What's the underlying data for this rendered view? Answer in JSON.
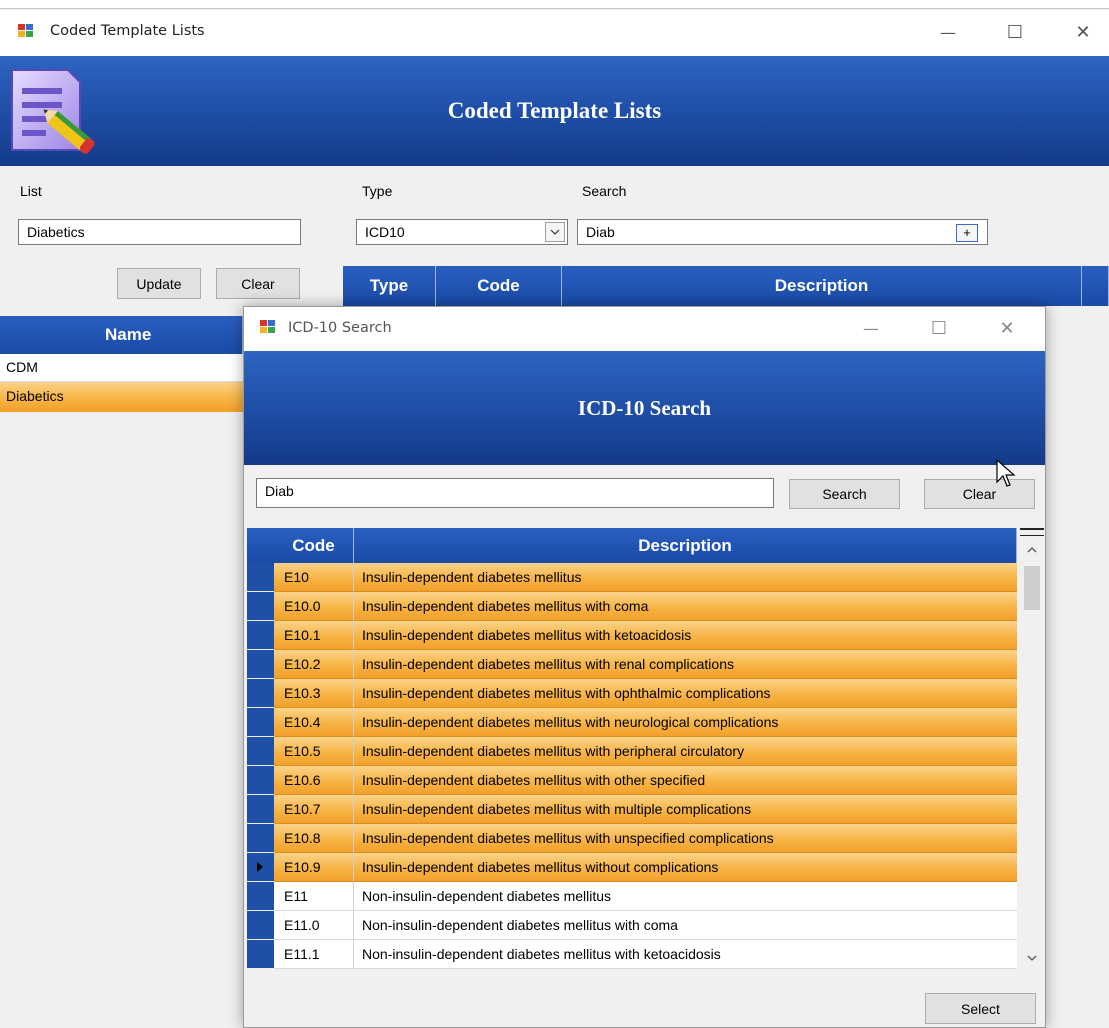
{
  "main_window": {
    "title": "Coded Template Lists",
    "banner_title": "Coded Template Lists",
    "controls": {
      "minimize": "—",
      "maximize": "☐",
      "close": "✕"
    },
    "list_label": "List",
    "list_value": "Diabetics",
    "type_label": "Type",
    "type_value": "ICD10",
    "search_label": "Search",
    "search_value": "Diab",
    "search_plus": "+",
    "update_button": "Update",
    "clear_button": "Clear",
    "names_grid": {
      "header": "Name",
      "rows": [
        {
          "name": "CDM",
          "selected": false
        },
        {
          "name": "Diabetics",
          "selected": true
        }
      ]
    },
    "codes_grid": {
      "headers": [
        "Type",
        "Code",
        "Description"
      ]
    }
  },
  "icd_dialog": {
    "title": "ICD-10 Search",
    "banner_title": "ICD-10 Search",
    "controls": {
      "minimize": "—",
      "maximize": "☐",
      "close": "✕"
    },
    "search_value": "Diab",
    "search_button": "Search",
    "clear_button": "Clear",
    "grid": {
      "headers": {
        "code": "Code",
        "description": "Description"
      },
      "rows": [
        {
          "code": "E10",
          "description": "Insulin-dependent diabetes mellitus",
          "highlighted": true
        },
        {
          "code": "E10.0",
          "description": "Insulin-dependent diabetes mellitus with coma",
          "highlighted": true
        },
        {
          "code": "E10.1",
          "description": "Insulin-dependent diabetes mellitus with ketoacidosis",
          "highlighted": true
        },
        {
          "code": "E10.2",
          "description": "Insulin-dependent diabetes mellitus with renal complications",
          "highlighted": true
        },
        {
          "code": "E10.3",
          "description": "Insulin-dependent diabetes mellitus with ophthalmic complications",
          "highlighted": true
        },
        {
          "code": "E10.4",
          "description": "Insulin-dependent diabetes mellitus with neurological complications",
          "highlighted": true
        },
        {
          "code": "E10.5",
          "description": "Insulin-dependent diabetes mellitus with peripheral circulatory",
          "highlighted": true
        },
        {
          "code": "E10.6",
          "description": "Insulin-dependent diabetes mellitus with other specified",
          "highlighted": true
        },
        {
          "code": "E10.7",
          "description": "Insulin-dependent diabetes mellitus with multiple complications",
          "highlighted": true
        },
        {
          "code": "E10.8",
          "description": "Insulin-dependent diabetes mellitus with unspecified complications",
          "highlighted": true
        },
        {
          "code": "E10.9",
          "description": "Insulin-dependent diabetes mellitus without complications",
          "highlighted": true,
          "current": true
        },
        {
          "code": "E11",
          "description": "Non-insulin-dependent diabetes mellitus",
          "highlighted": false
        },
        {
          "code": "E11.0",
          "description": "Non-insulin-dependent diabetes mellitus with coma",
          "highlighted": false
        },
        {
          "code": "E11.1",
          "description": "Non-insulin-dependent diabetes mellitus with ketoacidosis",
          "highlighted": false
        }
      ]
    },
    "select_button": "Select"
  },
  "colors": {
    "banner_blue": "#1f4fa8",
    "highlight_orange": "#f7b445",
    "selected_name_orange": "#f5b041"
  }
}
